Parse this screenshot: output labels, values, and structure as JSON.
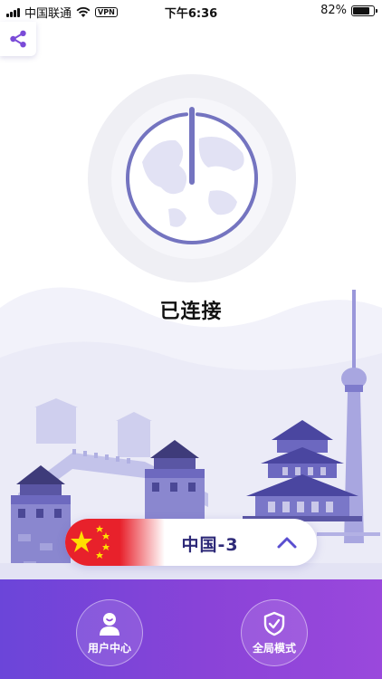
{
  "status_bar": {
    "carrier": "中国联通",
    "vpn_badge": "VPN",
    "time": "下午6:36",
    "battery_text": "82%",
    "battery_level": 0.82
  },
  "connection": {
    "status": "已连接"
  },
  "location": {
    "name": "中国-3",
    "flag": "china-flag"
  },
  "bottom_nav": {
    "user_center_label": "用户中心",
    "global_mode_label": "全局模式"
  },
  "icons": {
    "share": "share-icon",
    "power": "power-icon",
    "chevron": "chevron-up-icon",
    "user": "user-icon",
    "shield": "shield-check-icon"
  },
  "colors": {
    "accent": "#7474c0",
    "gradient_start": "#6b45d9",
    "gradient_end": "#9a48dc",
    "location_text": "#2e2a78"
  }
}
